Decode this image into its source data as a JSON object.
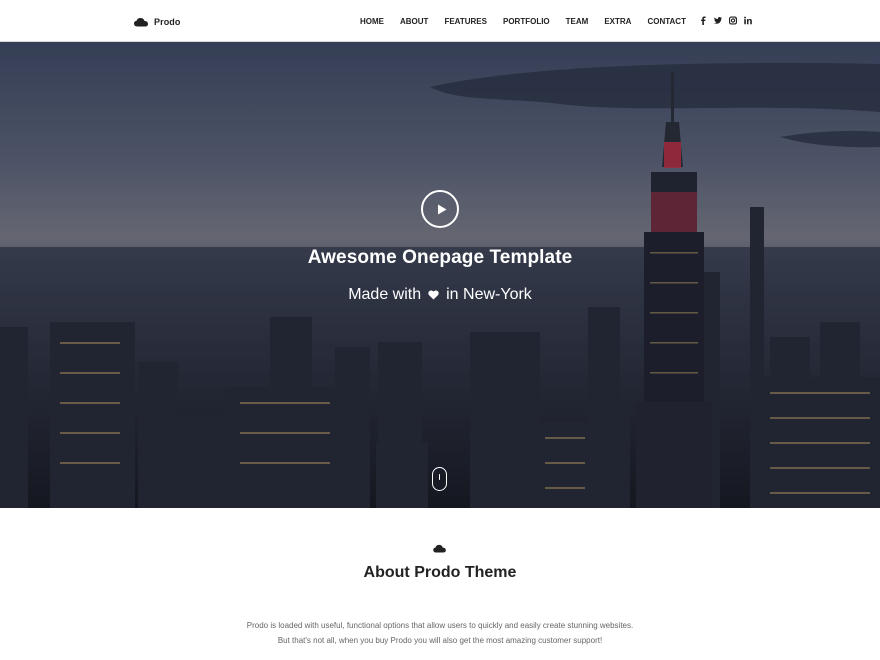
{
  "header": {
    "brand": "Prodo",
    "nav": [
      "HOME",
      "ABOUT",
      "FEATURES",
      "PORTFOLIO",
      "TEAM",
      "EXTRA",
      "CONTACT"
    ],
    "social_icons": [
      "facebook-icon",
      "twitter-icon",
      "instagram-icon",
      "linkedin-icon"
    ]
  },
  "hero": {
    "title": "Awesome Onepage Template",
    "subtitle_before": "Made with",
    "subtitle_after": "in New-York",
    "icons": [
      "play-icon",
      "heart-icon",
      "scroll-down-icon"
    ]
  },
  "about": {
    "icon": "cloud-icon",
    "title": "About Prodo Theme",
    "line1": "Prodo is loaded with useful, functional options that allow users to quickly and easily create stunning websites.",
    "line2": "But that's not all, when you buy Prodo you will also get the most amazing customer support!"
  }
}
